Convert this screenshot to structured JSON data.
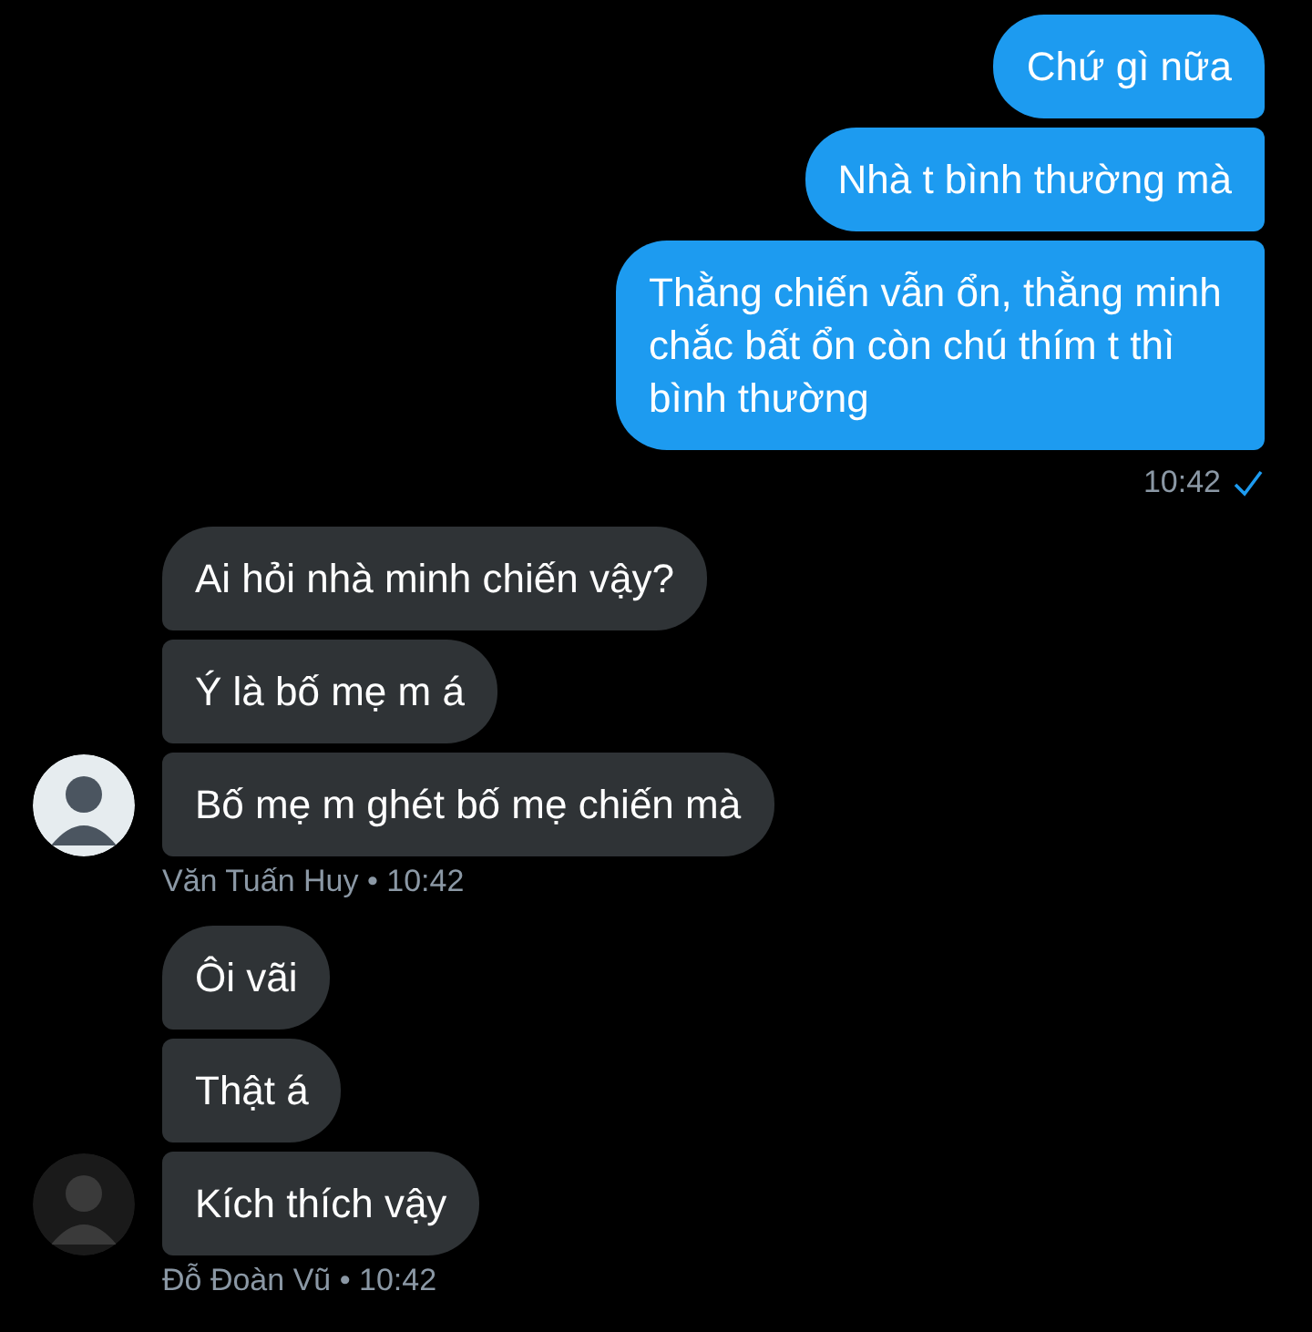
{
  "groups": [
    {
      "kind": "outgoing",
      "messages": [
        "Chứ gì nữa",
        "Nhà t bình thường mà",
        "Thằng chiến vẫn ổn, thằng minh chắc bất ổn còn chú thím t thì bình thường"
      ],
      "time": "10:42",
      "read": true
    },
    {
      "kind": "incoming",
      "messages": [
        "Ai hỏi nhà minh chiến vậy?",
        "Ý là bố mẹ m á",
        "Bố mẹ m ghét bố mẹ chiến mà"
      ],
      "meta": "Văn Tuấn Huy • 10:42"
    },
    {
      "kind": "incoming",
      "messages": [
        "Ôi vãi",
        "Thật á",
        "Kích thích vậy"
      ],
      "meta": "Đỗ Đoàn Vũ • 10:42"
    }
  ]
}
